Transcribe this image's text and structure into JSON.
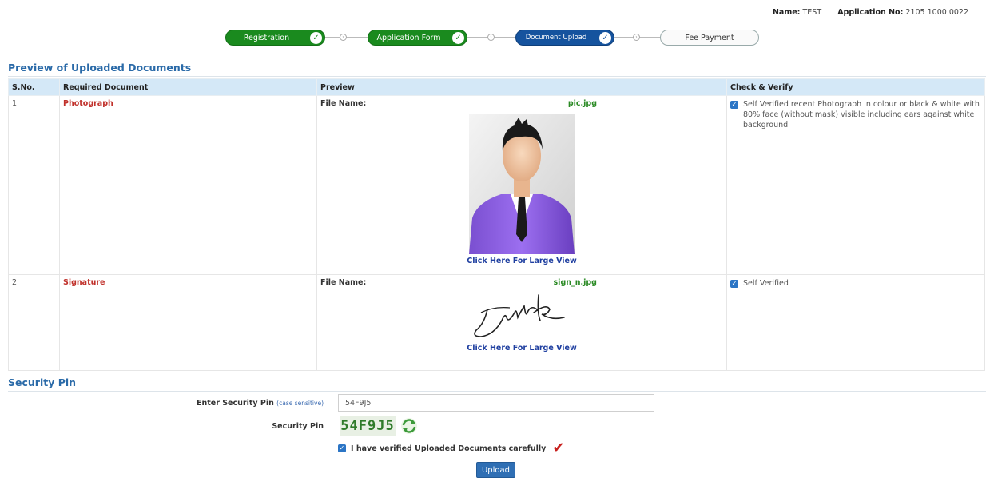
{
  "header": {
    "name_label": "Name:",
    "name_value": "TEST",
    "app_label": "Application No:",
    "app_value": "2105 1000 0022"
  },
  "stepper": {
    "steps": [
      {
        "label": "Registration",
        "state": "done"
      },
      {
        "label": "Application Form",
        "state": "done"
      },
      {
        "label": "Document Upload",
        "state": "current"
      },
      {
        "label": "Fee Payment",
        "state": "pending"
      }
    ],
    "connector_glyph": "›"
  },
  "preview_section": {
    "title": "Preview of Uploaded Documents",
    "columns": [
      "S.No.",
      "Required Document",
      "Preview",
      "Check & Verify"
    ],
    "rows": [
      {
        "sno": "1",
        "document": "Photograph",
        "file_label": "File Name:",
        "file_name": "pic.jpg",
        "large_view": "Click Here For Large View",
        "verify_text": "Self Verified recent Photograph in colour or black & white with 80% face (without mask) visible including ears against white background"
      },
      {
        "sno": "2",
        "document": "Signature",
        "file_label": "File Name:",
        "file_name": "sign_n.jpg",
        "large_view": "Click Here For Large View",
        "verify_text": "Self Verified"
      }
    ]
  },
  "security": {
    "title": "Security Pin",
    "enter_label": "Enter Security Pin",
    "case_note": "(case sensitive)",
    "input_value": "54F9J5",
    "pin_label": "Security Pin",
    "captcha_text": "54F9J5",
    "verify_label": "I have verified Uploaded Documents carefully",
    "upload_label": "Upload"
  },
  "colors": {
    "done": "#1a8a1e",
    "current": "#15539e",
    "section_title": "#2a6aa8",
    "doc_name": "#c0302a",
    "file_name": "#2a8a24",
    "link": "#1f3fa0"
  }
}
